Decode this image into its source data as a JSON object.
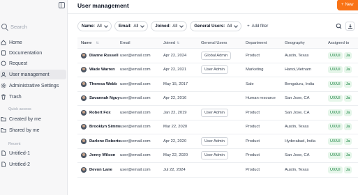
{
  "sidebar": {
    "search_placeholder": "Search",
    "items": [
      {
        "label": "Home",
        "icon": "home-icon"
      },
      {
        "label": "Documentation",
        "icon": "document-icon"
      },
      {
        "label": "Request",
        "icon": "circle-icon"
      },
      {
        "label": "User management",
        "icon": "user-icon",
        "active": true
      },
      {
        "label": "Administrative Settings",
        "icon": "gear-icon"
      },
      {
        "label": "Trash",
        "icon": "trash-icon"
      }
    ],
    "quick_access_label": "Quick access",
    "quick_access": [
      {
        "label": "Created by me",
        "icon": "folder-icon"
      },
      {
        "label": "Shared by me",
        "icon": "folder-icon"
      }
    ],
    "recent_label": "Recent",
    "recent": [
      {
        "label": "Untitled-1",
        "icon": "file-icon"
      },
      {
        "label": "Untitled-2",
        "icon": "file-icon"
      }
    ]
  },
  "header": {
    "title": "User management",
    "new_button": "New"
  },
  "filters": [
    {
      "label": "Name:",
      "value": "All"
    },
    {
      "label": "Email:",
      "value": "All"
    },
    {
      "label": "Joined:",
      "value": "All"
    },
    {
      "label": "General Users:",
      "value": "All"
    }
  ],
  "add_filter": "Add filter",
  "table": {
    "columns": [
      "Name",
      "Email",
      "Joined",
      "General Users",
      "Department",
      "Geography",
      "Assigned to"
    ],
    "rows": [
      {
        "name": "Dianne Russell",
        "email": "user@email.com",
        "joined": "Apr 22, 2024",
        "role": "Global Admin",
        "dept": "Product",
        "geo": "Austin, Texas",
        "tags": [
          "UX/UI",
          "Ja"
        ]
      },
      {
        "name": "Wade Warren",
        "email": "user@email.com",
        "joined": "Apr 22, 2021",
        "role": "User Admin",
        "dept": "Marketing",
        "geo": "Hanoi,Vietnam",
        "tags": [
          "UX/UI",
          "Ja"
        ]
      },
      {
        "name": "Theresa Webb",
        "email": "user@email.com",
        "joined": "May 15, 2017",
        "role": "",
        "dept": "Sale",
        "geo": "Bengaluru, India",
        "tags": [
          "UX/UI",
          "Ja"
        ]
      },
      {
        "name": "Savannah Nguyen",
        "email": "user@email.com",
        "joined": "Apr 22, 2016",
        "role": "",
        "dept": "Human resource",
        "geo": "San Jose, CA",
        "tags": [
          "UX/UI",
          "Ja"
        ]
      },
      {
        "name": "Robert Fox",
        "email": "user@email.com",
        "joined": "Jan 22, 2019",
        "role": "User Admin",
        "dept": "Product",
        "geo": "San Jose, CA",
        "tags": [
          "UX/UI",
          "Ja"
        ]
      },
      {
        "name": "Brooklyn Simmons",
        "email": "user@email.com",
        "joined": "Mar 22, 2020",
        "role": "",
        "dept": "Product",
        "geo": "Austin, Texas",
        "tags": [
          "UX/UI",
          "Ja"
        ]
      },
      {
        "name": "Darlene Robertson",
        "email": "user@email.com",
        "joined": "Apr 22, 2020",
        "role": "User Admin",
        "dept": "Product",
        "geo": "Hyderabad, India",
        "tags": [
          "UX/UI",
          "Ja"
        ]
      },
      {
        "name": "Jenny Wilson",
        "email": "user@email.com",
        "joined": "May 22, 2020",
        "role": "User Admin",
        "dept": "Product",
        "geo": "San Jose, CA",
        "tags": [
          "UX/UI",
          "Ja"
        ]
      },
      {
        "name": "Devon Lane",
        "email": "user@email.com",
        "joined": "Jul 22, 2024",
        "role": "",
        "dept": "Product",
        "geo": "Austin, Texas",
        "tags": [
          "UX/UI",
          "Ja"
        ]
      }
    ]
  },
  "colors": {
    "accent": "#f97316",
    "tag_bg": "#e6f6ea",
    "tag_text": "#15803d"
  }
}
